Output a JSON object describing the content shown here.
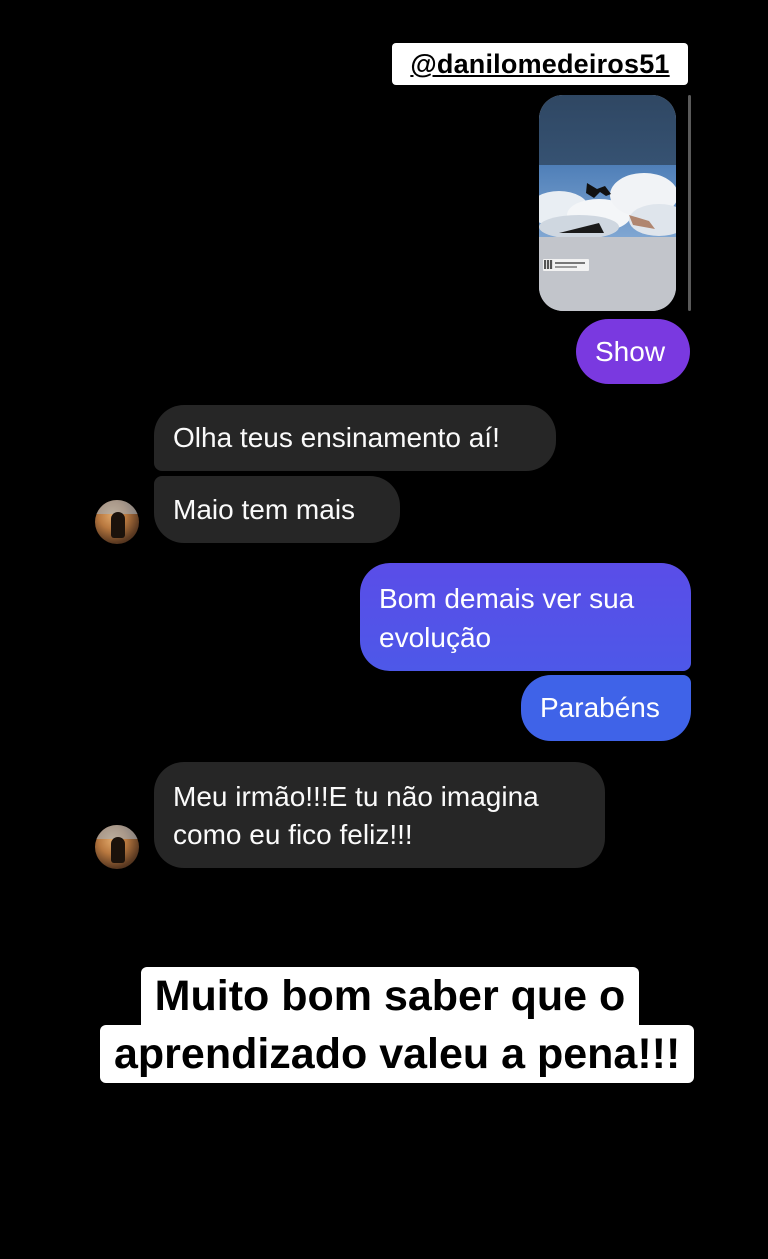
{
  "mention": "@danilomedeiros51",
  "messages": [
    {
      "id": "m1",
      "side": "outgoing",
      "text": "Show",
      "color": "#7a39e0"
    },
    {
      "id": "m2",
      "side": "incoming",
      "text": "Olha teus ensinamento aí!"
    },
    {
      "id": "m3",
      "side": "incoming",
      "text": "Maio tem mais"
    },
    {
      "id": "m4",
      "side": "outgoing",
      "lines": [
        "Bom demais ver sua",
        "evolução"
      ],
      "color": "#5151e6"
    },
    {
      "id": "m5",
      "side": "outgoing",
      "text": "Parabéns",
      "color": "#3f63e8"
    },
    {
      "id": "m6",
      "side": "incoming",
      "lines": [
        "Meu irmão!!!E tu não imagina",
        "como eu fico feliz!!!"
      ]
    }
  ],
  "caption": {
    "line1": "Muito bom saber que o",
    "line2": "aprendizado valeu a pena!!!"
  },
  "colors": {
    "background": "#000000",
    "incoming_bubble": "#262626",
    "outgoing_purple": "#7a39e0",
    "outgoing_blue_top": "#5a4de8",
    "outgoing_blue_bottom": "#3d65e8"
  },
  "icons": {
    "avatar": "profile-photo-avatar",
    "media": "skydiving-photo-preview"
  }
}
